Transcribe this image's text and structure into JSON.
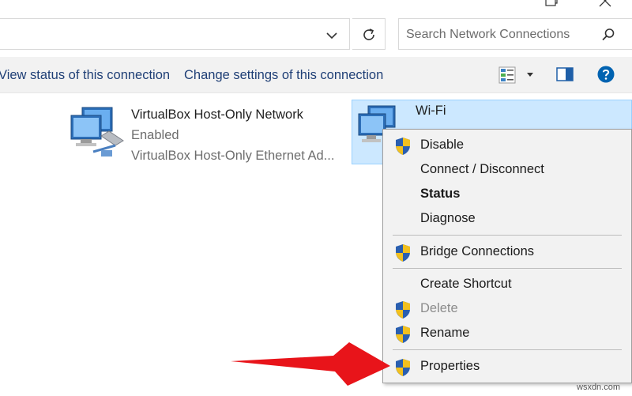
{
  "address_bar": {
    "search_placeholder": "Search Network Connections"
  },
  "command_bar": {
    "view_status_label": "View status of this connection",
    "change_settings_label": "Change settings of this connection"
  },
  "connections": [
    {
      "name": "VirtualBox Host-Only Network",
      "status": "Enabled",
      "adapter": "VirtualBox Host-Only Ethernet Ad..."
    },
    {
      "name": "Wi-Fi",
      "selected": true
    }
  ],
  "context_menu": {
    "items": [
      {
        "label": "Disable",
        "icon": "uac-shield-icon"
      },
      {
        "label": "Connect / Disconnect"
      },
      {
        "label": "Status",
        "bold": true
      },
      {
        "label": "Diagnose"
      },
      {
        "label": "Bridge Connections",
        "icon": "uac-shield-icon"
      },
      {
        "label": "Create Shortcut"
      },
      {
        "label": "Delete",
        "icon": "uac-shield-icon",
        "disabled": true
      },
      {
        "label": "Rename",
        "icon": "uac-shield-icon"
      },
      {
        "label": "Properties",
        "icon": "uac-shield-icon"
      }
    ]
  },
  "annotation": {
    "arrow_color": "#e8141a",
    "points_to": "Properties"
  },
  "watermark": "wsxdn.com",
  "colors": {
    "selection_bg": "#cce8ff",
    "link_blue": "#1f3f76",
    "menu_bg": "#f2f2f2",
    "help_blue": "#0063b1"
  }
}
